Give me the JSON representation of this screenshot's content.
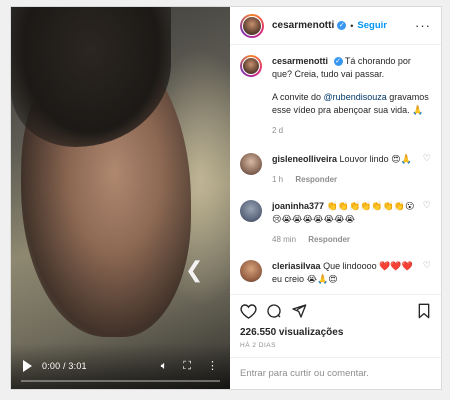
{
  "video": {
    "time": "0:00 / 3:01"
  },
  "header": {
    "username": "cesarmenotti",
    "follow_label": "Seguir",
    "separator": "•"
  },
  "caption": {
    "username": "cesarmenotti",
    "line1": "Tá chorando por que? Creia, tudo vai passar.",
    "line2_pre": "A convite do ",
    "mention": "@rubendisouza",
    "line2_post": " gravamos esse vídeo pra abençoar sua vida. 🙏",
    "age": "2 d"
  },
  "comments": [
    {
      "username": "gisleneolliveira",
      "text": "Louvor lindo 😍🙏",
      "age": "1 h",
      "reply": "Responder"
    },
    {
      "username": "joaninha377",
      "text": "👏👏👏👏👏👏👏😮😢😭😭😭😭😭😭😭",
      "age": "48 min",
      "reply": "Responder"
    },
    {
      "username": "cleriasilvaa",
      "text": "Que lindoooo ❤️❤️❤️ eu creio 😭🙏😍"
    }
  ],
  "actions": {
    "likes": "226.550 visualizações",
    "ago": "HÁ 2 DIAS",
    "add_comment_placeholder": "Entrar para curtir ou comentar."
  },
  "colors": {
    "link_blue": "#0095f6",
    "verified_blue": "#3897f0",
    "meta_gray": "#8e8e8e"
  }
}
